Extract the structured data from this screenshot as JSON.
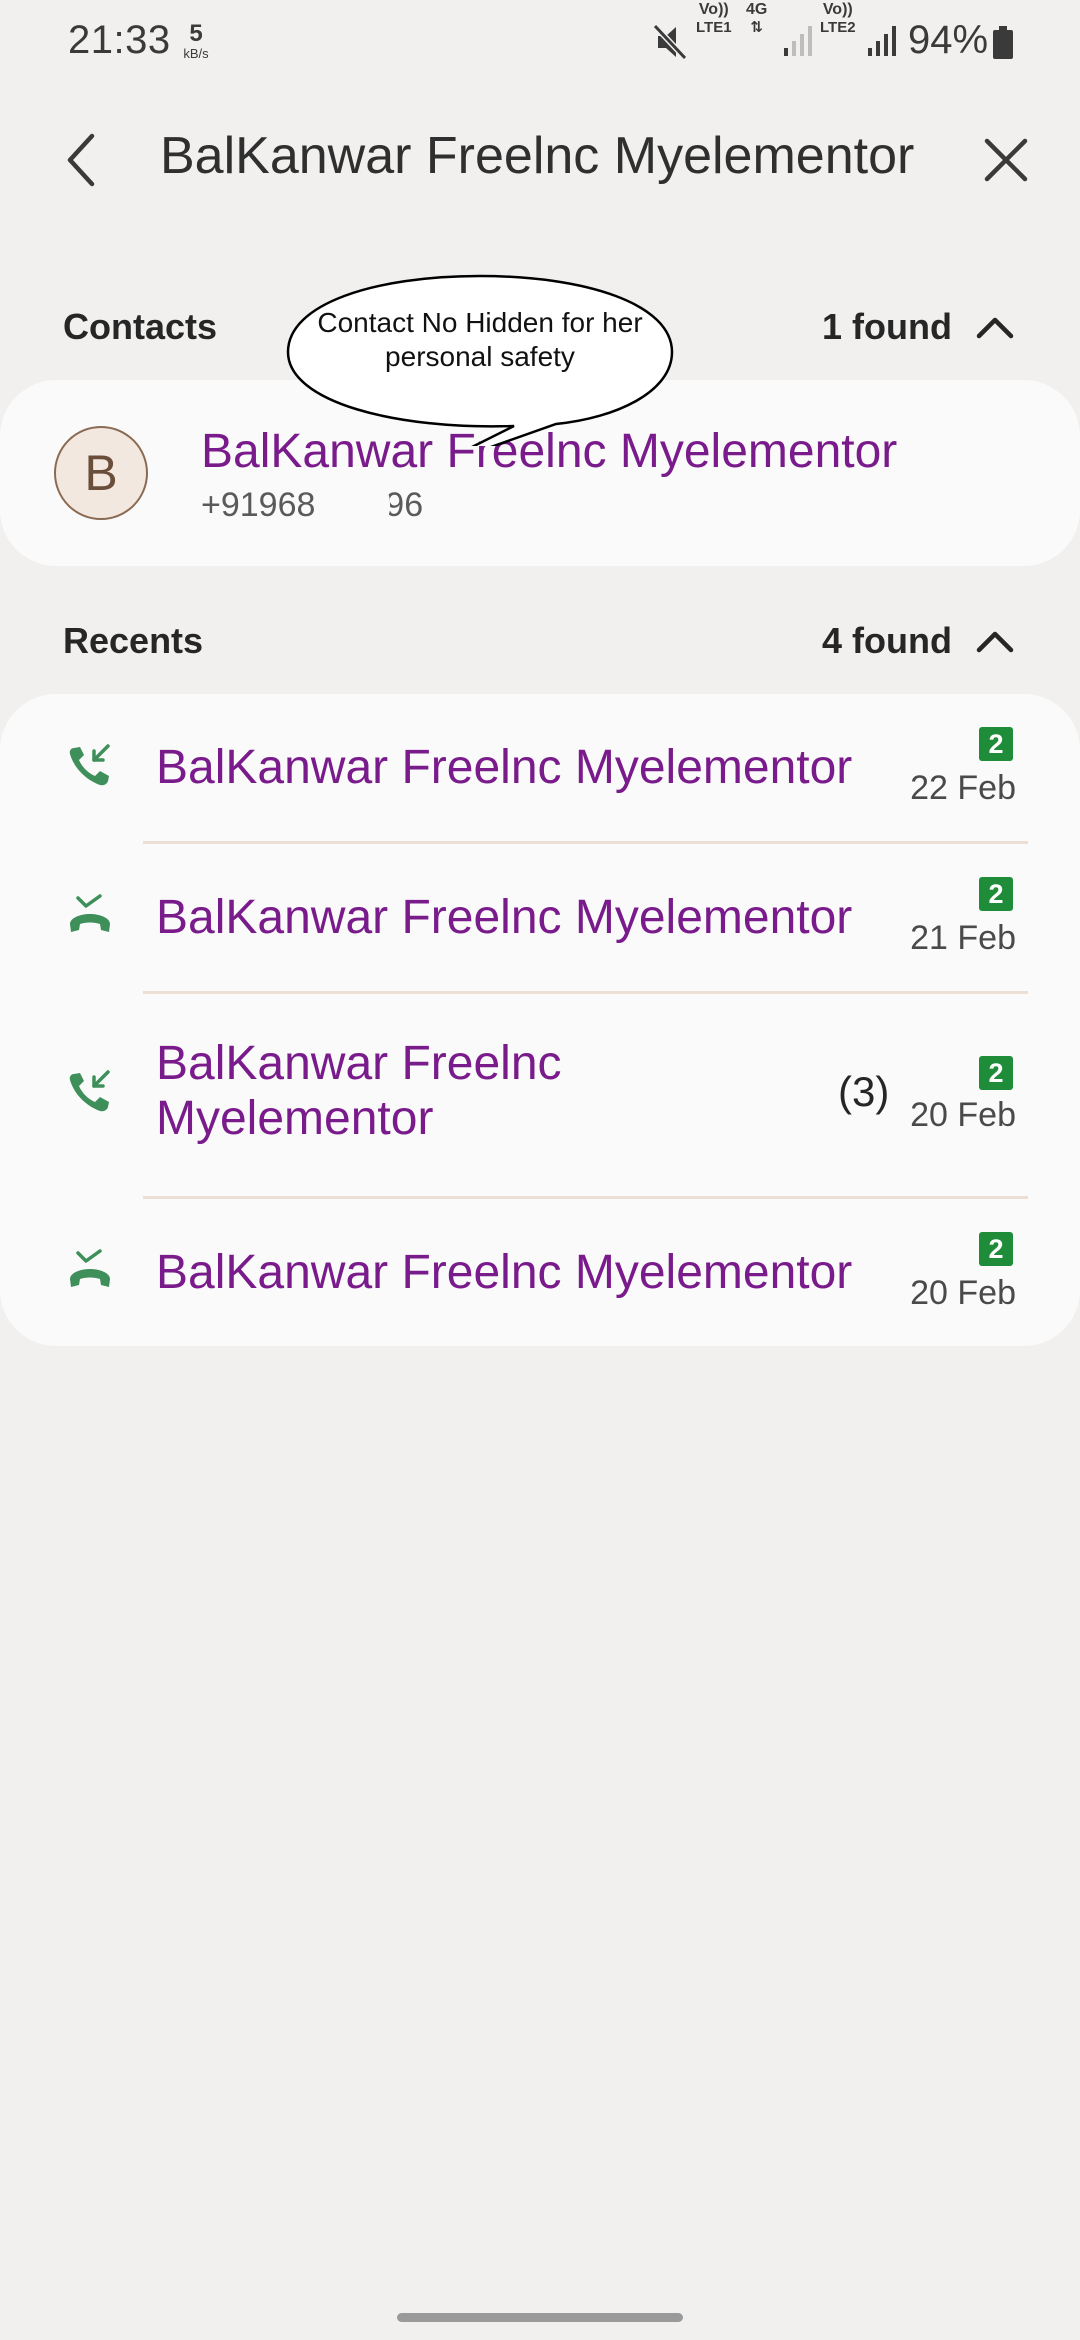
{
  "status_bar": {
    "time": "21:33",
    "speed_value": "5",
    "speed_unit": "kB/s",
    "sim1_top": "Vo))",
    "sim1_bottom": "LTE1",
    "net_type": "4G",
    "sim2_top": "Vo))",
    "sim2_bottom": "LTE2",
    "battery": "94%",
    "icons": [
      "mute-icon",
      "signal-icon",
      "battery-icon"
    ]
  },
  "header": {
    "query": "BalKanwar Freelnc Myelementor",
    "icons": [
      "back-arrow-icon",
      "close-icon"
    ]
  },
  "contacts": {
    "title": "Contacts",
    "count": "1 found",
    "item": {
      "avatar_letter": "B",
      "name": "BalKanwar Freelnc Myelementor",
      "number": "+91968 ‑ ‑ 996"
    },
    "annotation": "Contact No Hidden for her personal safety"
  },
  "recents": {
    "title": "Recents",
    "count": "4 found",
    "items": [
      {
        "name": "BalKanwar Freelnc Myelementor",
        "type": "incoming-call-icon",
        "sim": "2",
        "date": "22 Feb",
        "count": ""
      },
      {
        "name": "BalKanwar Freelnc Myelementor",
        "type": "missed-call-icon",
        "sim": "2",
        "date": "21 Feb",
        "count": ""
      },
      {
        "name": "BalKanwar Freelnc Myelementor",
        "type": "incoming-call-icon",
        "sim": "2",
        "date": "20 Feb",
        "count": "(3)"
      },
      {
        "name": "BalKanwar Freelnc Myelementor",
        "type": "missed-call-icon",
        "sim": "2",
        "date": "20 Feb",
        "count": ""
      }
    ]
  },
  "colors": {
    "background": "#f1f0ef",
    "card": "#fafafa",
    "name_purple": "#7a1b8c",
    "call_icon_green": "#3f8f5a",
    "sim_badge_green": "#1e8c39"
  }
}
